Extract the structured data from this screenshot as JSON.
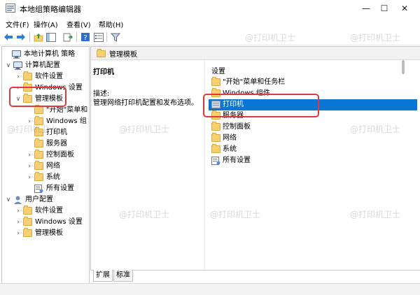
{
  "window": {
    "title": "本地组策略编辑器",
    "minimize": "—",
    "maximize": "☐",
    "close": "✕"
  },
  "menu": [
    "文件(F)",
    "操作(A)",
    "查看(V)",
    "帮助(H)"
  ],
  "toolbar": {
    "icons": [
      "back-arrow-icon",
      "forward-arrow-icon",
      "up-folder-icon",
      "show-hide-tree-icon",
      "export-list-icon",
      "help-icon",
      "properties-icon",
      "filter-icon"
    ]
  },
  "tree": {
    "items": [
      {
        "label": "本地计算机 策略",
        "level": 0,
        "twisty": "",
        "icon": "computer-policy-icon"
      },
      {
        "label": "计算机配置",
        "level": 1,
        "twisty": "∨",
        "icon": "computer-icon"
      },
      {
        "label": "软件设置",
        "level": 2,
        "twisty": "›",
        "icon": "folder-icon"
      },
      {
        "label": "Windows 设置",
        "level": 2,
        "twisty": "›",
        "icon": "folder-icon"
      },
      {
        "label": "管理模板",
        "level": 2,
        "twisty": "∨",
        "icon": "folder-icon"
      },
      {
        "label": "\"开始\"菜单和",
        "level": 3,
        "twisty": "",
        "icon": "folder-icon"
      },
      {
        "label": "Windows 组",
        "level": 3,
        "twisty": "›",
        "icon": "folder-icon"
      },
      {
        "label": "打印机",
        "level": 3,
        "twisty": "",
        "icon": "folder-icon"
      },
      {
        "label": "服务器",
        "level": 3,
        "twisty": "",
        "icon": "folder-icon"
      },
      {
        "label": "控制面板",
        "level": 3,
        "twisty": "›",
        "icon": "folder-icon"
      },
      {
        "label": "网络",
        "level": 3,
        "twisty": "›",
        "icon": "folder-icon"
      },
      {
        "label": "系统",
        "level": 3,
        "twisty": "›",
        "icon": "folder-icon"
      },
      {
        "label": "所有设置",
        "level": 3,
        "twisty": "",
        "icon": "all-settings-icon"
      },
      {
        "label": "用户配置",
        "level": 1,
        "twisty": "∨",
        "icon": "user-icon"
      },
      {
        "label": "软件设置",
        "level": 2,
        "twisty": "›",
        "icon": "folder-icon"
      },
      {
        "label": "Windows 设置",
        "level": 2,
        "twisty": "›",
        "icon": "folder-icon"
      },
      {
        "label": "管理模板",
        "level": 2,
        "twisty": "›",
        "icon": "folder-icon"
      }
    ]
  },
  "right": {
    "header": "管理模板",
    "detail_title": "打印机",
    "desc_label": "描述:",
    "desc_text": "管理网络打印机配置和发布选项。",
    "column_header": "设置",
    "items": [
      {
        "label": "\"开始\"菜单和任务栏",
        "icon": "folder-icon",
        "selected": false
      },
      {
        "label": "Windows 组件",
        "icon": "folder-icon",
        "selected": false
      },
      {
        "label": "打印机",
        "icon": "folder-icon",
        "selected": true
      },
      {
        "label": "服务器",
        "icon": "folder-icon",
        "selected": false
      },
      {
        "label": "控制面板",
        "icon": "folder-icon",
        "selected": false
      },
      {
        "label": "网络",
        "icon": "folder-icon",
        "selected": false
      },
      {
        "label": "系统",
        "icon": "folder-icon",
        "selected": false
      },
      {
        "label": "所有设置",
        "icon": "all-settings-icon",
        "selected": false
      }
    ]
  },
  "tabs": [
    "扩展",
    "标准"
  ],
  "watermark": "@打印机卫士",
  "colors": {
    "selection": "#0a76d6",
    "highlight_box": "#e23a3a",
    "folder": "#f5cf72"
  }
}
